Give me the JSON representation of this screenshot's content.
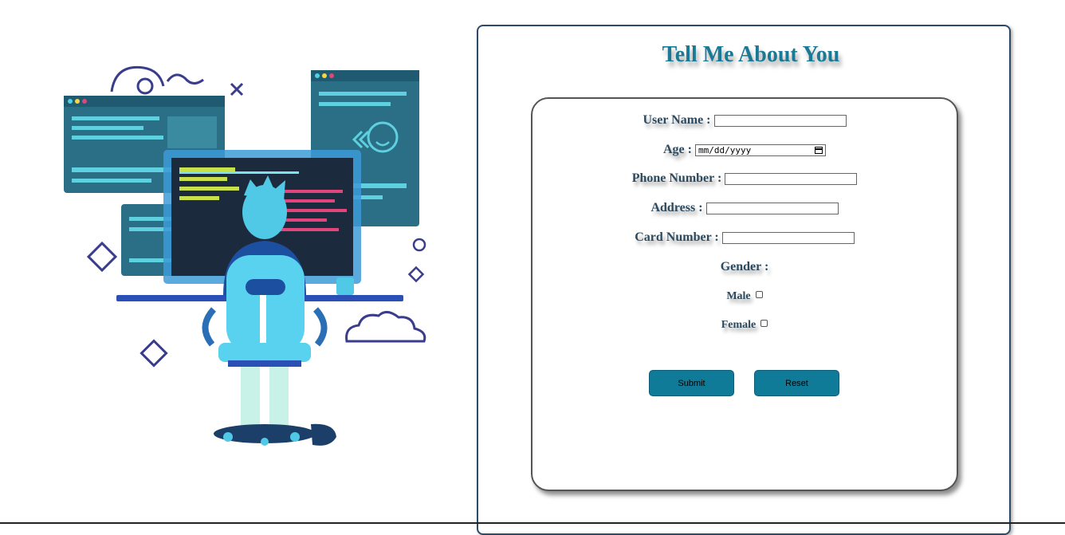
{
  "form": {
    "title": "Tell Me About You",
    "fields": {
      "username": {
        "label": "User Name :",
        "value": ""
      },
      "age": {
        "label": "Age :",
        "placeholder": "mm/dd/yyyy"
      },
      "phone": {
        "label": "Phone Number :",
        "value": ""
      },
      "address": {
        "label": "Address :",
        "value": ""
      },
      "card": {
        "label": "Card Number :",
        "value": ""
      }
    },
    "gender": {
      "label": "Gender :",
      "options": [
        {
          "label": "Male",
          "checked": false
        },
        {
          "label": "Female",
          "checked": false
        }
      ]
    },
    "buttons": {
      "submit": "Submit",
      "reset": "Reset"
    }
  },
  "illustration": {
    "icon": "developer-at-desk-illustration"
  },
  "colors": {
    "title": "#1a7a96",
    "label": "#2d4a5e",
    "button": "#107a99",
    "panel_border": "#2e4a6b"
  }
}
